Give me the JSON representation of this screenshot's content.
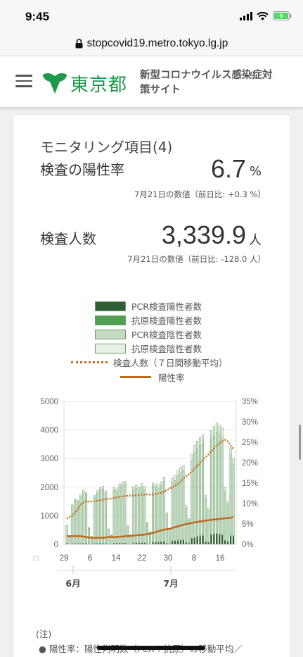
{
  "status_bar": {
    "time": "9:45"
  },
  "browser": {
    "url": "stopcovid19.metro.tokyo.lg.jp"
  },
  "header": {
    "logo_text": "東京都",
    "site_title": "新型コロナウイルス感染症対策サイト"
  },
  "card": {
    "title": "モニタリング項目(4)",
    "positivity": {
      "label": "検査の陽性率",
      "value": "6.7",
      "unit": "%",
      "note": "7月21日の数値（前日比: +0.3 %）"
    },
    "tests": {
      "label": "検査人数",
      "value": "3,339.9",
      "unit": "人",
      "note": "7月21日の数値（前日比: -128.0 人）"
    }
  },
  "legend": {
    "items": [
      {
        "label": "PCR検査陽性者数",
        "color": "#2e5e34",
        "kind": "swatch"
      },
      {
        "label": "抗原検査陽性者数",
        "color": "#4ea050",
        "kind": "swatch"
      },
      {
        "label": "PCR検査陰性者数",
        "color": "#c3dcc0",
        "kind": "swatch"
      },
      {
        "label": "抗原検査陰性者数",
        "color": "#e6f2e3",
        "kind": "swatch"
      },
      {
        "label": "検査人数（７日間移動平均）",
        "color": "#c26a1a",
        "kind": "dotted-line"
      },
      {
        "label": "陽性率",
        "color": "#c26a1a",
        "kind": "solid-line"
      }
    ]
  },
  "chart_data": {
    "type": "bar",
    "left_axis": {
      "ticks": [
        0,
        1000,
        2000,
        3000,
        4000,
        5000
      ],
      "range": [
        0,
        5000
      ]
    },
    "right_axis": {
      "ticks": [
        "0%",
        "5%",
        "10%",
        "15%",
        "20%",
        "25%",
        "30%",
        "35%"
      ],
      "range": [
        0,
        35
      ]
    },
    "x_tick_labels": [
      "21",
      "29",
      "6",
      "14",
      "22",
      "30",
      "8",
      "16"
    ],
    "month_labels": [
      "6月",
      "7月"
    ],
    "series": [
      {
        "name": "PCR検査陽性者数",
        "values": [
          30,
          8,
          20,
          25,
          22,
          24,
          28,
          30,
          10,
          6,
          26,
          28,
          30,
          32,
          28,
          10,
          8,
          34,
          36,
          40,
          38,
          36,
          12,
          8,
          45,
          50,
          48,
          52,
          55,
          20,
          15,
          65,
          70,
          80,
          85,
          90,
          30,
          20,
          110,
          120,
          130,
          140,
          150,
          60,
          40,
          200,
          230,
          260,
          280,
          300,
          90,
          70,
          330,
          350,
          360,
          340,
          320,
          130,
          90,
          300,
          280
        ]
      },
      {
        "name": "抗原検査陽性者数",
        "values": [
          5,
          2,
          4,
          5,
          4,
          5,
          5,
          6,
          2,
          1,
          5,
          5,
          6,
          6,
          5,
          2,
          2,
          6,
          7,
          7,
          7,
          6,
          2,
          2,
          8,
          9,
          8,
          9,
          9,
          4,
          3,
          10,
          11,
          12,
          13,
          14,
          5,
          4,
          15,
          16,
          17,
          18,
          19,
          8,
          6,
          22,
          24,
          26,
          27,
          28,
          10,
          8,
          30,
          31,
          32,
          31,
          30,
          12,
          9,
          28,
          27
        ]
      },
      {
        "name": "PCR検査陰性者数",
        "values": [
          600,
          250,
          1300,
          1500,
          1450,
          1650,
          1800,
          1700,
          550,
          250,
          1600,
          1750,
          1850,
          1900,
          1750,
          500,
          300,
          1850,
          1800,
          1950,
          2000,
          2050,
          600,
          300,
          1850,
          1900,
          1850,
          1950,
          1850,
          700,
          400,
          1950,
          1900,
          1850,
          1950,
          2100,
          1000,
          500,
          2050,
          2100,
          2250,
          2350,
          2400,
          1200,
          800,
          2700,
          2950,
          3050,
          3150,
          3200,
          1500,
          1100,
          3300,
          3400,
          3500,
          3450,
          3400,
          1700,
          1300,
          2800,
          2500
        ]
      },
      {
        "name": "抗原検査陰性者数",
        "values": [
          40,
          20,
          60,
          70,
          70,
          80,
          90,
          90,
          30,
          15,
          80,
          90,
          95,
          100,
          90,
          30,
          20,
          100,
          100,
          110,
          115,
          120,
          40,
          20,
          110,
          115,
          110,
          120,
          115,
          45,
          25,
          125,
          125,
          130,
          140,
          150,
          70,
          40,
          160,
          170,
          180,
          190,
          200,
          90,
          60,
          240,
          260,
          280,
          290,
          300,
          120,
          90,
          320,
          340,
          350,
          340,
          330,
          140,
          100,
          250,
          210
        ]
      },
      {
        "name": "検査人数（７日間移動平均）",
        "values": [
          900,
          950,
          1000,
          1100,
          1250,
          1400,
          1450,
          1500,
          1500,
          1500,
          1510,
          1520,
          1540,
          1560,
          1580,
          1590,
          1600,
          1620,
          1640,
          1660,
          1680,
          1690,
          1700,
          1700,
          1710,
          1720,
          1720,
          1730,
          1740,
          1750,
          1740,
          1740,
          1760,
          1780,
          1800,
          1840,
          1900,
          1950,
          2000,
          2050,
          2120,
          2200,
          2300,
          2380,
          2450,
          2550,
          2650,
          2750,
          2850,
          2950,
          3050,
          3150,
          3250,
          3350,
          3450,
          3550,
          3600,
          3650,
          3600,
          3450,
          3350
        ]
      },
      {
        "name": "陽性率",
        "values": [
          2.0,
          2.0,
          2.0,
          2.0,
          2.0,
          2.0,
          1.9,
          1.8,
          1.7,
          1.6,
          1.6,
          1.6,
          1.6,
          1.6,
          1.7,
          1.8,
          1.8,
          1.8,
          1.8,
          1.9,
          1.9,
          2.0,
          2.0,
          2.1,
          2.1,
          2.2,
          2.3,
          2.3,
          2.4,
          2.5,
          2.6,
          2.8,
          3.0,
          3.2,
          3.4,
          3.6,
          3.7,
          3.8,
          4.0,
          4.2,
          4.4,
          4.6,
          4.8,
          5.0,
          5.1,
          5.2,
          5.4,
          5.5,
          5.6,
          5.7,
          5.8,
          5.9,
          6.0,
          6.1,
          6.1,
          6.2,
          6.3,
          6.4,
          6.4,
          6.5,
          6.7
        ]
      }
    ]
  },
  "notes": {
    "heading": "(注)",
    "items": [
      "陽性率：陽性判明数（PCR＋抗原）の移動平均／"
    ]
  }
}
